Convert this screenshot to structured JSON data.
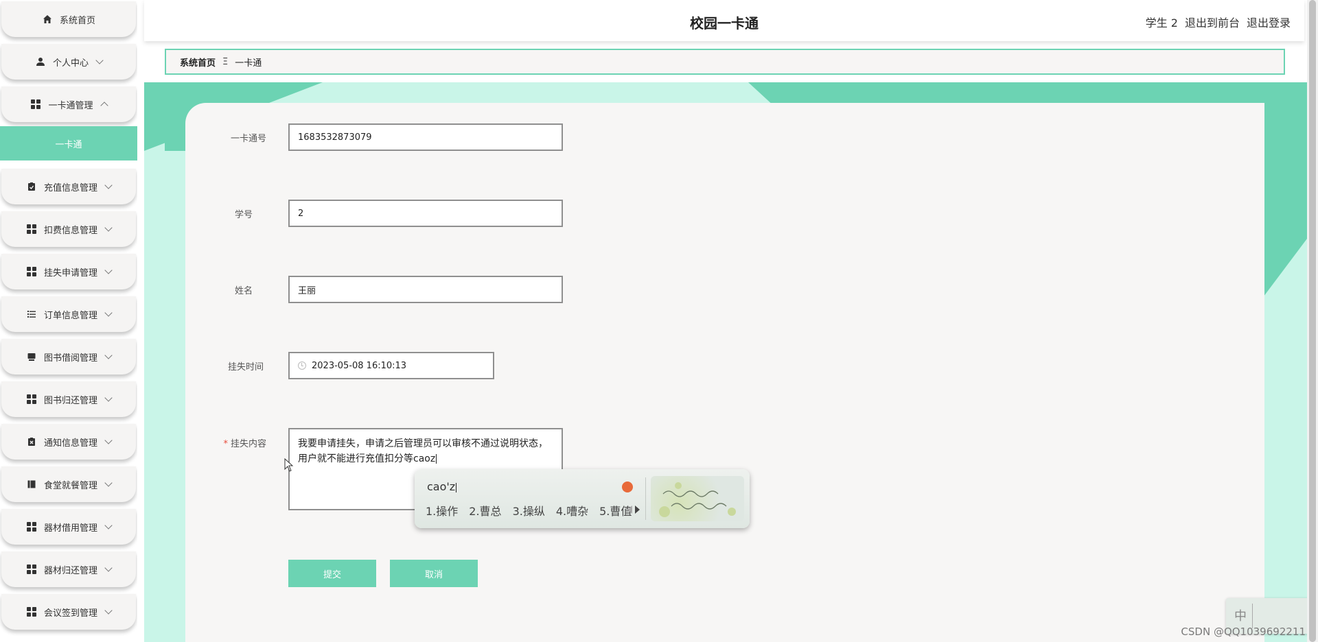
{
  "header": {
    "title": "校园一卡通",
    "user": "学生 2",
    "front_link": "退出到前台",
    "logout_link": "退出登录"
  },
  "sidebar": {
    "items": [
      {
        "label": "系统首页",
        "icon": "home-icon"
      },
      {
        "label": "个人中心",
        "icon": "user-icon"
      },
      {
        "label": "一卡通管理",
        "icon": "grid-icon"
      },
      {
        "label": "充值信息管理",
        "icon": "clipboard-icon"
      },
      {
        "label": "扣费信息管理",
        "icon": "grid-icon"
      },
      {
        "label": "挂失申请管理",
        "icon": "grid-icon"
      },
      {
        "label": "订单信息管理",
        "icon": "list-icon"
      },
      {
        "label": "图书借阅管理",
        "icon": "book-icon"
      },
      {
        "label": "图书归还管理",
        "icon": "grid-icon"
      },
      {
        "label": "通知信息管理",
        "icon": "clipboard-x-icon"
      },
      {
        "label": "食堂就餐管理",
        "icon": "notebook-icon"
      },
      {
        "label": "器材借用管理",
        "icon": "grid-icon"
      },
      {
        "label": "器材归还管理",
        "icon": "grid-icon"
      },
      {
        "label": "会议签到管理",
        "icon": "grid-icon"
      }
    ],
    "submenu_label": "一卡通"
  },
  "breadcrumb": {
    "home": "系统首页",
    "separator": "Ξ",
    "current": "一卡通"
  },
  "form": {
    "card_no_label": "一卡通号",
    "card_no_value": "1683532873079",
    "student_id_label": "学号",
    "student_id_value": "2",
    "name_label": "姓名",
    "name_value": "王丽",
    "loss_time_label": "挂失时间",
    "loss_time_value": "2023-05-08 16:10:13",
    "content_required_mark": "*",
    "content_label": "挂失内容",
    "content_line1": "我要申请挂失，申请之后管理员可以审核不通过说明状态，",
    "content_line2": "用户就不能进行充值扣分等caoz",
    "submit_label": "提交",
    "cancel_label": "取消"
  },
  "ime": {
    "pinyin": "cao'z",
    "candidates": [
      "1.操作",
      "2.曹总",
      "3.操纵",
      "4.嘈杂",
      "5.曹值"
    ],
    "mini_mode": "中"
  },
  "watermark": "CSDN @QQ1039692211",
  "colors": {
    "accent": "#6cd3b3",
    "content_bg": "#c9f5e8",
    "panel_bg": "#f7f6f5"
  }
}
